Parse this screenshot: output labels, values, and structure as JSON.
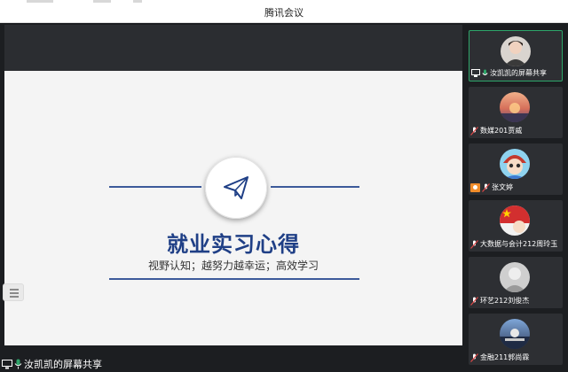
{
  "window": {
    "title": "腾讯会议"
  },
  "slide": {
    "title": "就业实习心得",
    "subtitle": "视野认知；越努力越幸运；高效学习",
    "icon": "paper-plane-icon",
    "accent_color": "#1f3f86"
  },
  "screen_share": {
    "label": "汝凯凯的屏幕共享"
  },
  "participants": [
    {
      "name": "汝凯凯的屏幕共享",
      "avatar_color": "#8c8c8c",
      "active": true
    },
    {
      "name": "数媒201贾威",
      "avatar_color": "#c98a6a",
      "active": false
    },
    {
      "name": "张文婷",
      "avatar_color": "#6bb6d8",
      "active": false,
      "host": true
    },
    {
      "name": "大数据与会计212周玲玉",
      "avatar_color": "#d22f2f",
      "active": false
    },
    {
      "name": "环艺212刘俊杰",
      "avatar_color": "#a7a7a7",
      "active": false
    },
    {
      "name": "金融211郭尚霖",
      "avatar_color": "#4a5a78",
      "active": false
    }
  ],
  "colors": {
    "active_border": "#2ea56a",
    "stage_bg": "#1c1e21"
  }
}
